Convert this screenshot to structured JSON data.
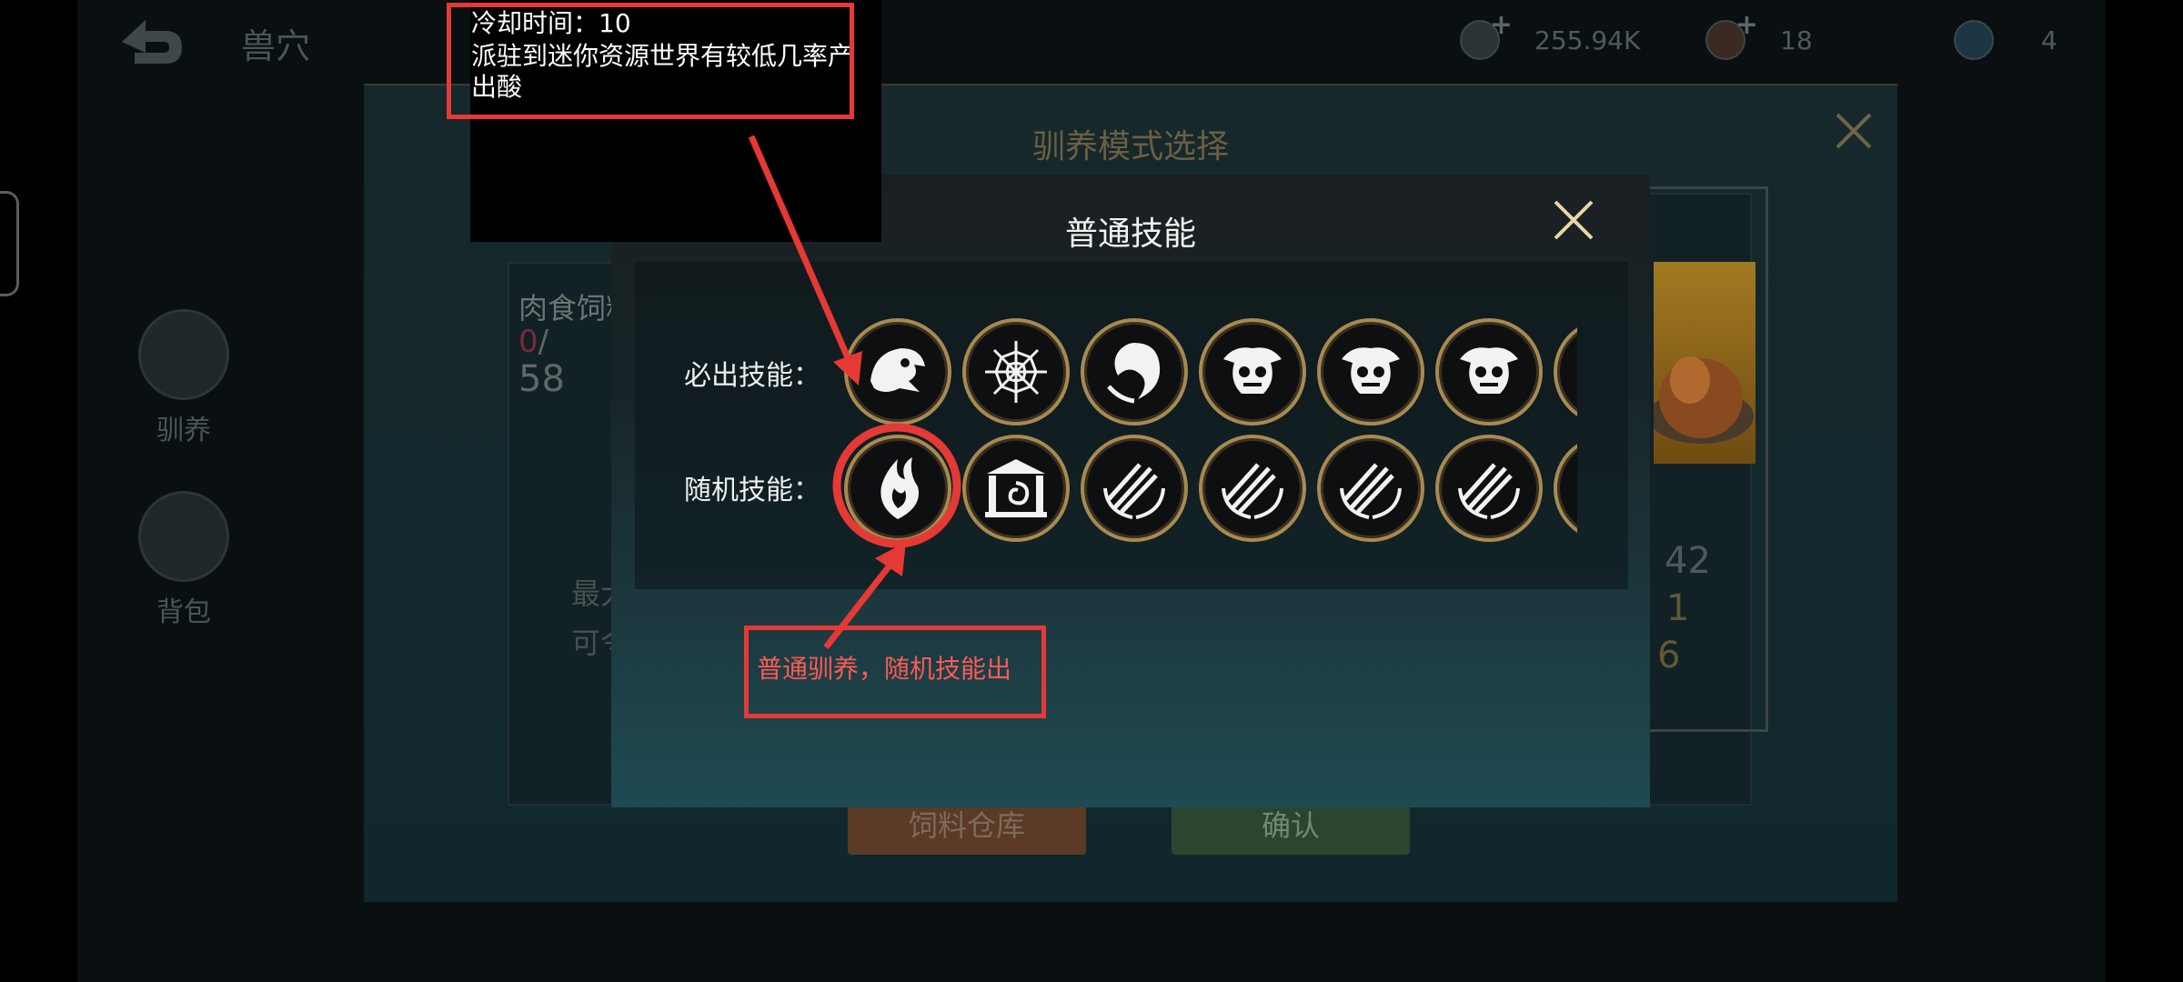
{
  "topbar": {
    "title": "兽穴",
    "resources": [
      {
        "icon": "gold-coin-icon",
        "value": "255.94K"
      },
      {
        "icon": "gem-icon",
        "value": "18"
      },
      {
        "icon": "token-icon",
        "value": "4"
      }
    ]
  },
  "side_tabs": [
    {
      "label": "驯养",
      "icon": "beast-head-icon"
    },
    {
      "label": "背包",
      "icon": "bag-icon"
    }
  ],
  "mode_modal": {
    "title": "驯养模式选择",
    "card_left": {
      "name": "肉食饲料",
      "current": "0",
      "sep": "/",
      "max": "58"
    },
    "bottom_left_lines": [
      "最大",
      "可令"
    ],
    "right_stats": [
      "42",
      "1",
      "6"
    ],
    "buttons": {
      "feed_store": "饲料仓库",
      "confirm": "确认"
    }
  },
  "popup": {
    "title": "普通技能",
    "guaranteed_label": "必出技能：",
    "random_label": "随机技能：",
    "guaranteed_skills": [
      "dragon-head-icon",
      "spider-web-icon",
      "wave-serpent-icon",
      "bull-skull-icon",
      "bull-skull-icon",
      "bull-skull-icon"
    ],
    "random_skills": [
      "spirit-flame-icon",
      "temple-vortex-icon",
      "wind-slash-icon",
      "wind-slash-icon",
      "wind-slash-icon",
      "wind-slash-icon"
    ],
    "help": "?"
  },
  "annotations": {
    "tooltip_lines": [
      "冷却时间：10",
      "派驻到迷你资源世界有较低几率产",
      "出酸"
    ],
    "arrow_label": "普通驯养，随机技能出"
  },
  "colors": {
    "accent_gold": "#a78a52",
    "annotation_red": "#e53935"
  }
}
